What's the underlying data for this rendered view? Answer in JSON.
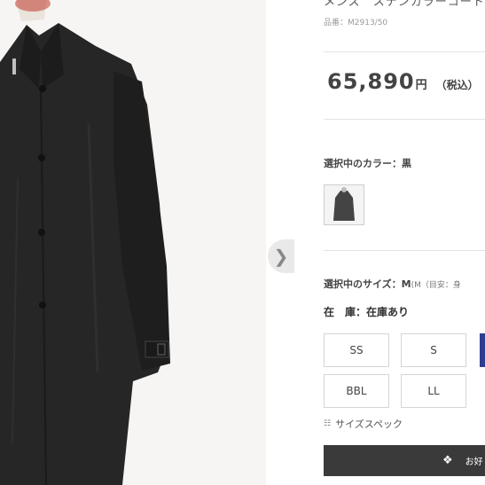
{
  "product": {
    "title": "メンズ　ステンカラーコート",
    "sku": "品番：M2913/50",
    "price_value": "65,890",
    "price_unit": "円",
    "price_tax": "（税込）"
  },
  "color": {
    "label": "選択中のカラー：",
    "value": "黒"
  },
  "size": {
    "label": "選択中のサイズ：",
    "value": "M",
    "detail": "(M（目安：身",
    "options": [
      "SS",
      "S",
      "BBL",
      "LL"
    ]
  },
  "stock": {
    "label": "在　庫：",
    "value": "在庫あり"
  },
  "spec_link": "サイズスペック",
  "cart_button": "お好",
  "icons": {
    "gallery_next": "chevron-right-icon",
    "spec": "grid-icon",
    "cart": "gift-icon"
  },
  "colors": {
    "coat": "#262626",
    "selected_size": "#2e3d8f",
    "cart_button": "#3a3a3a"
  }
}
